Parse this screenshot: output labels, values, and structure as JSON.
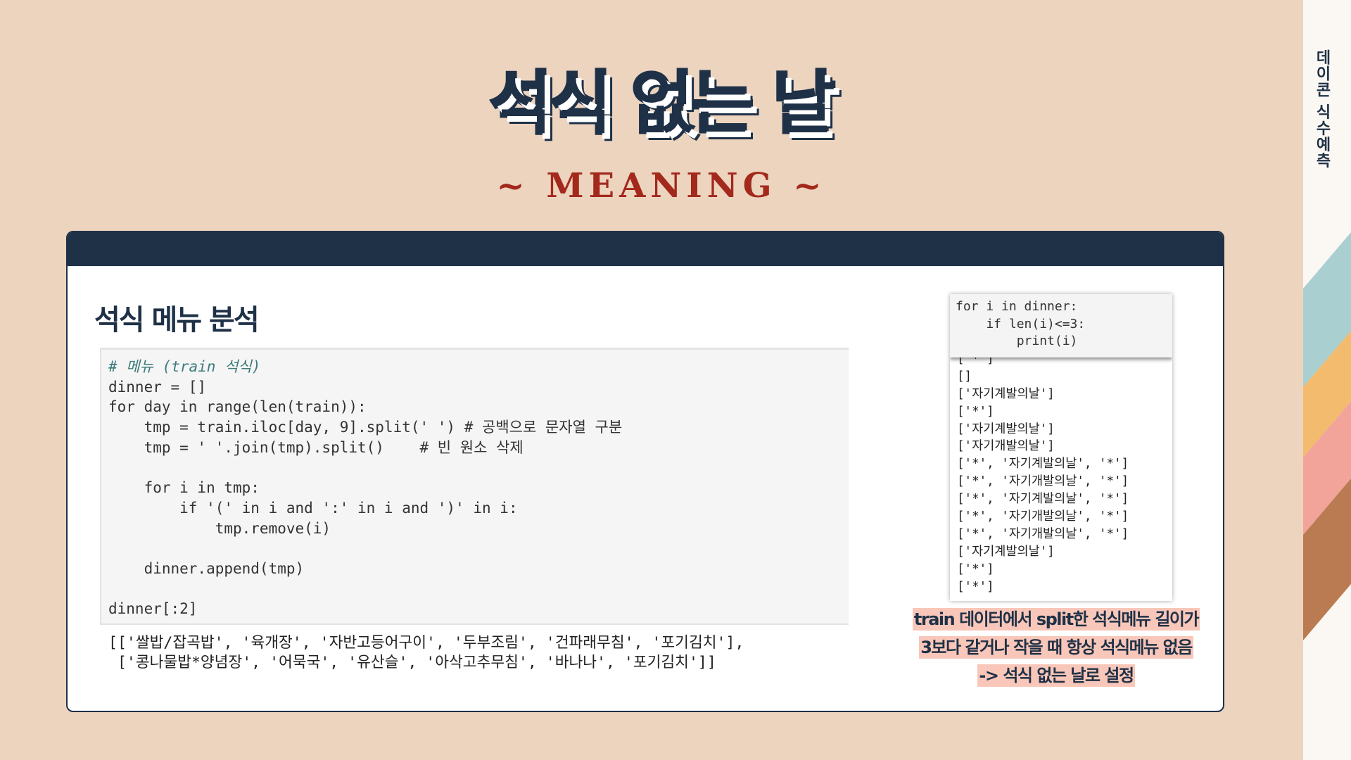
{
  "side_label": "데이콘 식수예측",
  "title": "석식 없는 날",
  "subtitle": "~ MEANING ~",
  "section_title": "석식 메뉴 분석",
  "code_lines": [
    "# 메뉴 (train 석식)",
    "dinner = []",
    "for day in range(len(train)):",
    "    tmp = train.iloc[day, 9].split(' ') # 공백으로 문자열 구분",
    "    tmp = ' '.join(tmp).split()    # 빈 원소 삭제",
    "",
    "    for i in tmp:",
    "        if '(' in i and ':' in i and ')' in i:",
    "            tmp.remove(i)",
    "",
    "    dinner.append(tmp)",
    "",
    "dinner[:2]"
  ],
  "output_lines": [
    "[['쌀밥/잡곡밥', '육개장', '자반고등어구이', '두부조림', '건파래무침', '포기김치'],",
    " ['콩나물밥*양념장', '어묵국', '유산슬', '아삭고추무침', '바나나', '포기김치']]"
  ],
  "popup_code_lines": [
    "for i in dinner:",
    "    if len(i)<=3:",
    "        print(i)"
  ],
  "popup_output_lines": [
    "['*']",
    "[]",
    "['자기계발의날']",
    "['*']",
    "['자기계발의날']",
    "['자기개발의날']",
    "['*', '자기계발의날', '*']",
    "['*', '자기개발의날', '*']",
    "['*', '자기계발의날', '*']",
    "['*', '자기개발의날', '*']",
    "['*', '자기개발의날', '*']",
    "['자기계발의날']",
    "['*']",
    "['*']"
  ],
  "note_lines": [
    "train 데이터에서 split한 석식메뉴 길이가",
    "3보다 같거나 작을 때 항상 석식메뉴 없음",
    "-> 석식 없는 날로 설정"
  ],
  "colors": {
    "background": "#edd4bf",
    "navy": "#1f3147",
    "accent_red": "#a3291c",
    "highlight": "#f9c7b9",
    "stripe_teal": "#a9cfd0",
    "stripe_yellow": "#f2bb6e",
    "stripe_pink": "#f2a49b",
    "stripe_brown": "#bb7b52"
  }
}
